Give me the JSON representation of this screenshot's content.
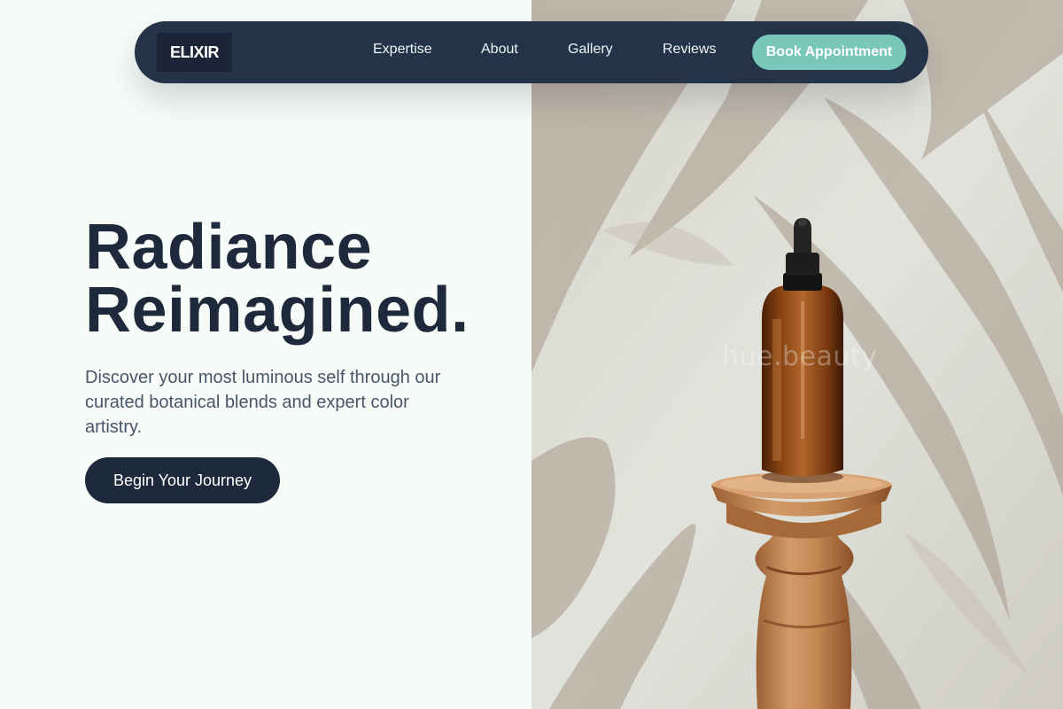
{
  "nav": {
    "logo": "ELIXIR",
    "links": [
      "Expertise",
      "About",
      "Gallery",
      "Reviews"
    ],
    "cta_label": "Book Appointment"
  },
  "hero": {
    "headline_line1": "Radiance",
    "headline_line2": "Reimagined.",
    "subtitle": "Discover your most luminous self through our curated botanical blends and expert color artistry.",
    "cta_label": "Begin Your Journey"
  },
  "image": {
    "watermark": "hue.beauty",
    "subject": "amber-dropper-bottle-on-wooden-pedestal"
  },
  "colors": {
    "navy": "#1e293b",
    "accent_mint": "#79c7b8",
    "background": "#f7fcf8",
    "body_text": "#475569"
  }
}
